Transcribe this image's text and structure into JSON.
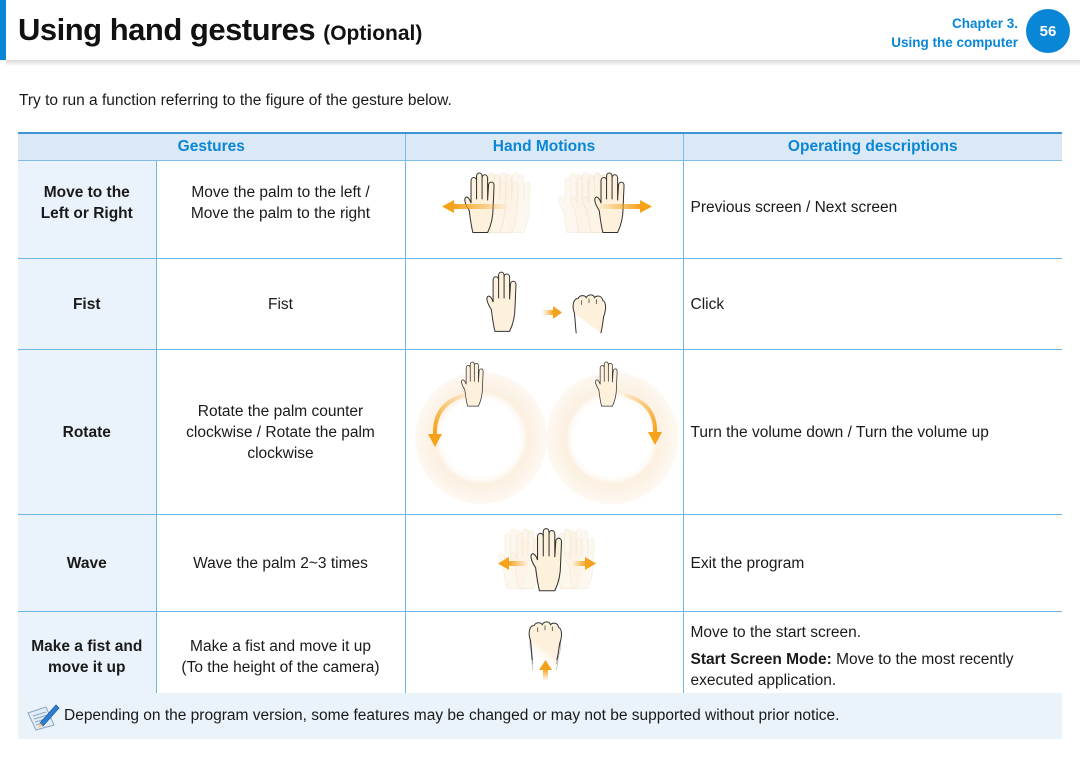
{
  "header": {
    "title": "Using hand gestures",
    "title_suffix": "(Optional)",
    "chapter_label": "Chapter 3.",
    "chapter_title": "Using the computer",
    "page_number": "56",
    "accent_color": "#0a86d6"
  },
  "intro": "Try to run a function referring to the figure of the gesture below.",
  "table": {
    "columns": [
      "Gestures",
      "Hand Motions",
      "Operating descriptions"
    ],
    "rows": [
      {
        "name_line1": "Move to the",
        "name_line2": "Left or Right",
        "desc_line1": "Move the palm to the left /",
        "desc_line2": "Move the palm to the right",
        "desc_line3": "",
        "figure": "palm-move-left-right",
        "op_line1": "Previous screen / Next screen"
      },
      {
        "name_line1": "Fist",
        "desc_line1": "Fist",
        "figure": "palm-to-fist",
        "op_line1": "Click"
      },
      {
        "name_line1": "Rotate",
        "desc_line1": "Rotate the palm counter",
        "desc_line2": "clockwise / Rotate the palm",
        "desc_line3": "clockwise",
        "figure": "palm-rotate",
        "op_line1": "Turn the volume down / Turn the volume up"
      },
      {
        "name_line1": "Wave",
        "desc_line1": "Wave the palm 2~3 times",
        "figure": "palm-wave",
        "op_line1": "Exit the program"
      },
      {
        "name_line1": "Make a fist and",
        "name_line2": "move it up",
        "desc_line1": "Make a fist and move it up",
        "desc_line2": "(To the height of the camera)",
        "figure": "fist-move-up",
        "op_line1": "Move to the start screen.",
        "op_bold": "Start Screen Mode:",
        "op_line2": " Move to the most recently",
        "op_line3": "executed application."
      }
    ]
  },
  "note": {
    "icon": "memo-pencil-icon",
    "text": "Depending on the program version, some features may be changed or may not be supported without prior notice."
  },
  "colors": {
    "accent": "#0a86d6",
    "header_bg": "#dbe9f6",
    "gesture_col_bg": "#eaf2fb",
    "arrow": "#f5a21b",
    "hand_fill": "#fdf1dc"
  }
}
